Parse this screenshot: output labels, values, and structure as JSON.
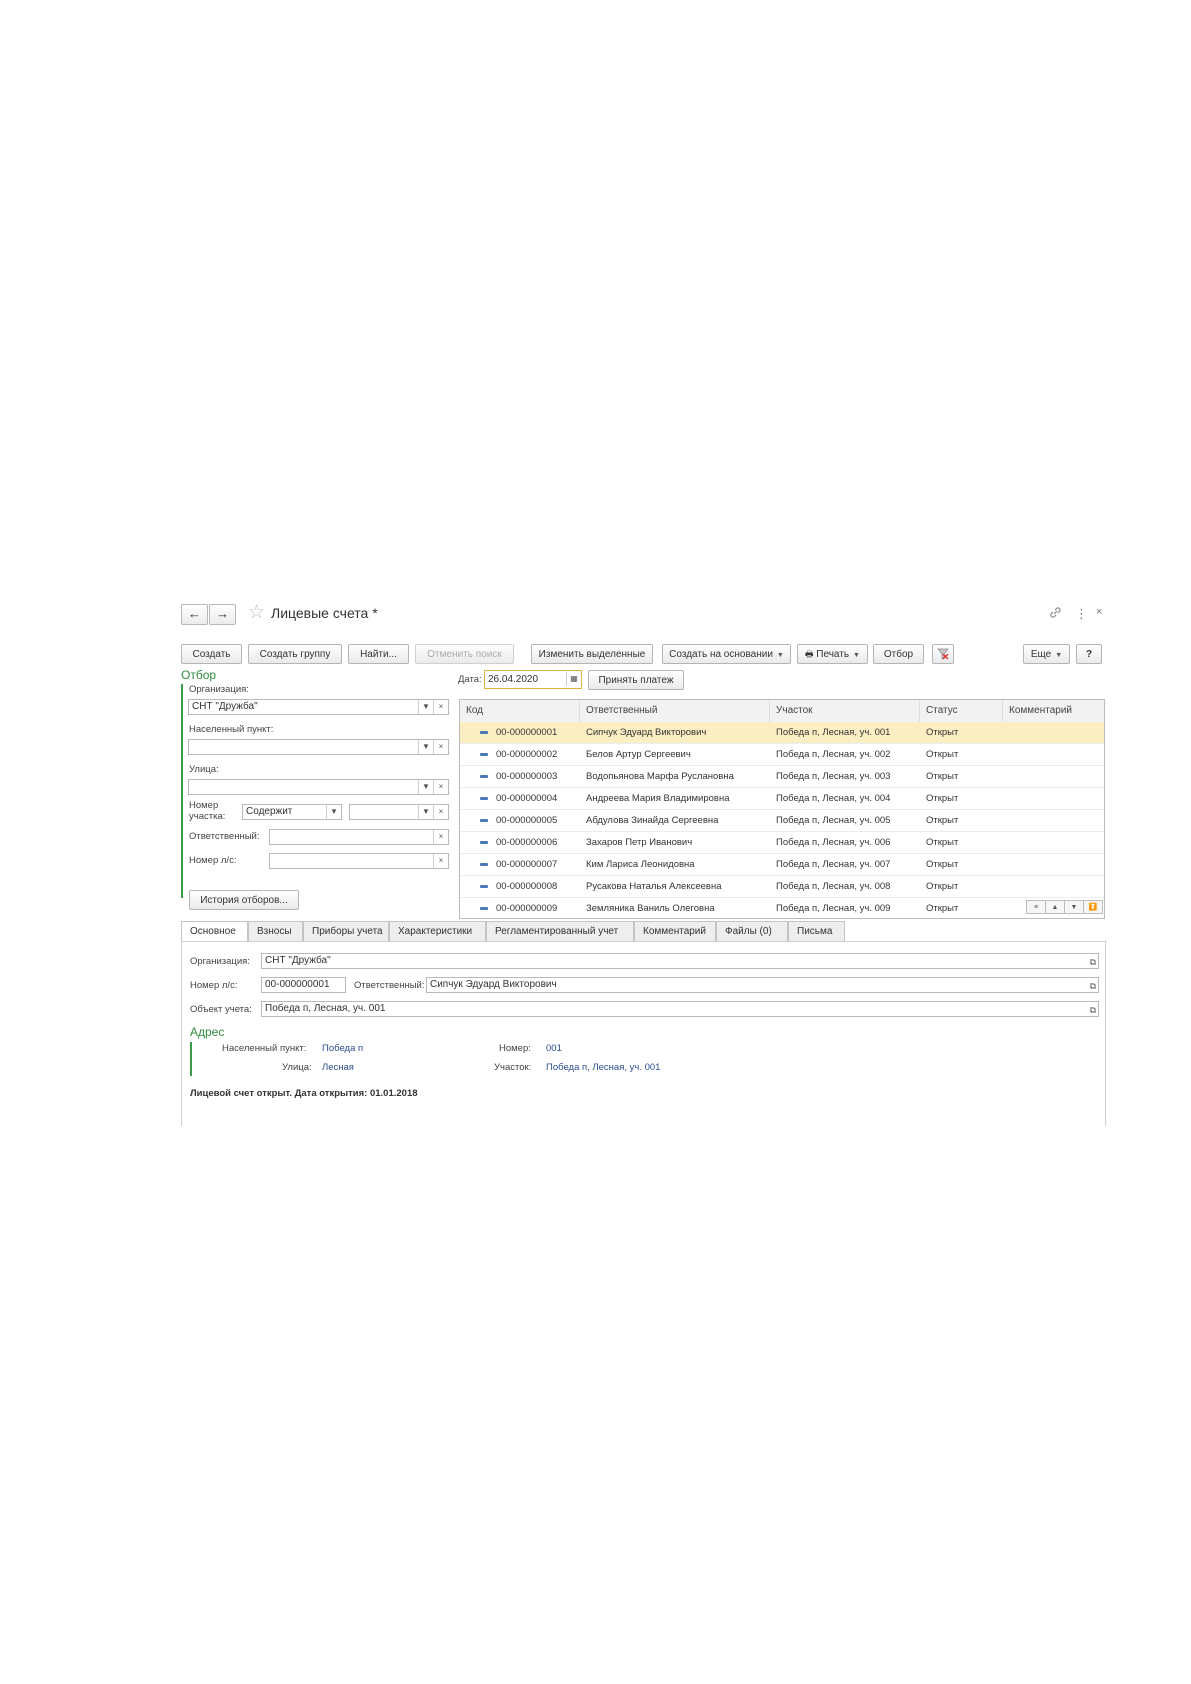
{
  "header": {
    "back": "←",
    "forward": "→",
    "star": "☆",
    "title": "Лицевые счета *",
    "icons": [
      "link-icon",
      "more-icon",
      "close-icon"
    ]
  },
  "toolbar": {
    "create": "Создать",
    "create_group": "Создать группу",
    "find": "Найти...",
    "cancel_search": "Отменить поиск",
    "edit_selected": "Изменить выделенные",
    "create_based": "Создать на основании",
    "print": "Печать",
    "filter": "Отбор",
    "more": "Еще",
    "help": "?"
  },
  "date_row": {
    "label": "Дата:",
    "value": "26.04.2020",
    "accept_payment": "Принять платеж"
  },
  "filter_panel": {
    "title": "Отбор",
    "org_label": "Организация:",
    "org_value": "СНТ \"Дружба\"",
    "settlement_label": "Населенный пункт:",
    "street_label": "Улица:",
    "plot_label_1": "Номер",
    "plot_label_2": "участка:",
    "plot_condition": "Содержит",
    "responsible_label": "Ответственный:",
    "account_label": "Номер л/с:",
    "history_button": "История отборов..."
  },
  "table": {
    "columns": [
      "Код",
      "Ответственный",
      "Участок",
      "Статус",
      "Комментарий"
    ],
    "rows": [
      {
        "code": "00-000000001",
        "person": "Сипчук Эдуард Викторович",
        "plot": "Победа п, Лесная, уч. 001",
        "status": "Открыт"
      },
      {
        "code": "00-000000002",
        "person": "Белов Артур Сергеевич",
        "plot": "Победа п, Лесная, уч. 002",
        "status": "Открыт"
      },
      {
        "code": "00-000000003",
        "person": "Водопьянова Марфа Руслановна",
        "plot": "Победа п, Лесная, уч. 003",
        "status": "Открыт"
      },
      {
        "code": "00-000000004",
        "person": "Андреева Мария Владимировна",
        "plot": "Победа п, Лесная, уч. 004",
        "status": "Открыт"
      },
      {
        "code": "00-000000005",
        "person": "Абдулова Зинайда Сергеевна",
        "plot": "Победа п, Лесная, уч. 005",
        "status": "Открыт"
      },
      {
        "code": "00-000000006",
        "person": "Захаров Петр Иванович",
        "plot": "Победа п, Лесная, уч. 006",
        "status": "Открыт"
      },
      {
        "code": "00-000000007",
        "person": "Ким Лариса Леонидовна",
        "plot": "Победа п, Лесная, уч. 007",
        "status": "Открыт"
      },
      {
        "code": "00-000000008",
        "person": "Русакова Наталья Алексеевна",
        "plot": "Победа п, Лесная, уч. 008",
        "status": "Открыт"
      },
      {
        "code": "00-000000009",
        "person": "Земляника Ваниль Олеговна",
        "plot": "Победа п, Лесная, уч. 009",
        "status": "Открыт"
      }
    ],
    "selected_index": 0
  },
  "tabs": [
    "Основное",
    "Взносы",
    "Приборы учета",
    "Характеристики",
    "Регламентированный учет",
    "Комментарий",
    "Файлы (0)",
    "Письма"
  ],
  "details": {
    "org_label": "Организация:",
    "org_value": "СНТ \"Дружба\"",
    "account_label": "Номер л/с:",
    "account_value": "00-000000001",
    "responsible_label": "Ответственный:",
    "responsible_value": "Сипчук Эдуард Викторович",
    "object_label": "Объект учета:",
    "object_value": "Победа п, Лесная, уч. 001",
    "address_title": "Адрес",
    "settlement_label": "Населенный пункт:",
    "settlement_value": "Победа п",
    "street_label": "Улица:",
    "street_value": "Лесная",
    "number_label": "Номер:",
    "number_value": "001",
    "plot_label": "Участок:",
    "plot_value": "Победа п, Лесная, уч. 001",
    "status_line": "Лицевой счет открыт. Дата открытия: 01.01.2018"
  },
  "colors": {
    "accent_green": "#3a9c4a",
    "selected_row": "#fbeec2",
    "link_blue": "#2b4f8f"
  }
}
